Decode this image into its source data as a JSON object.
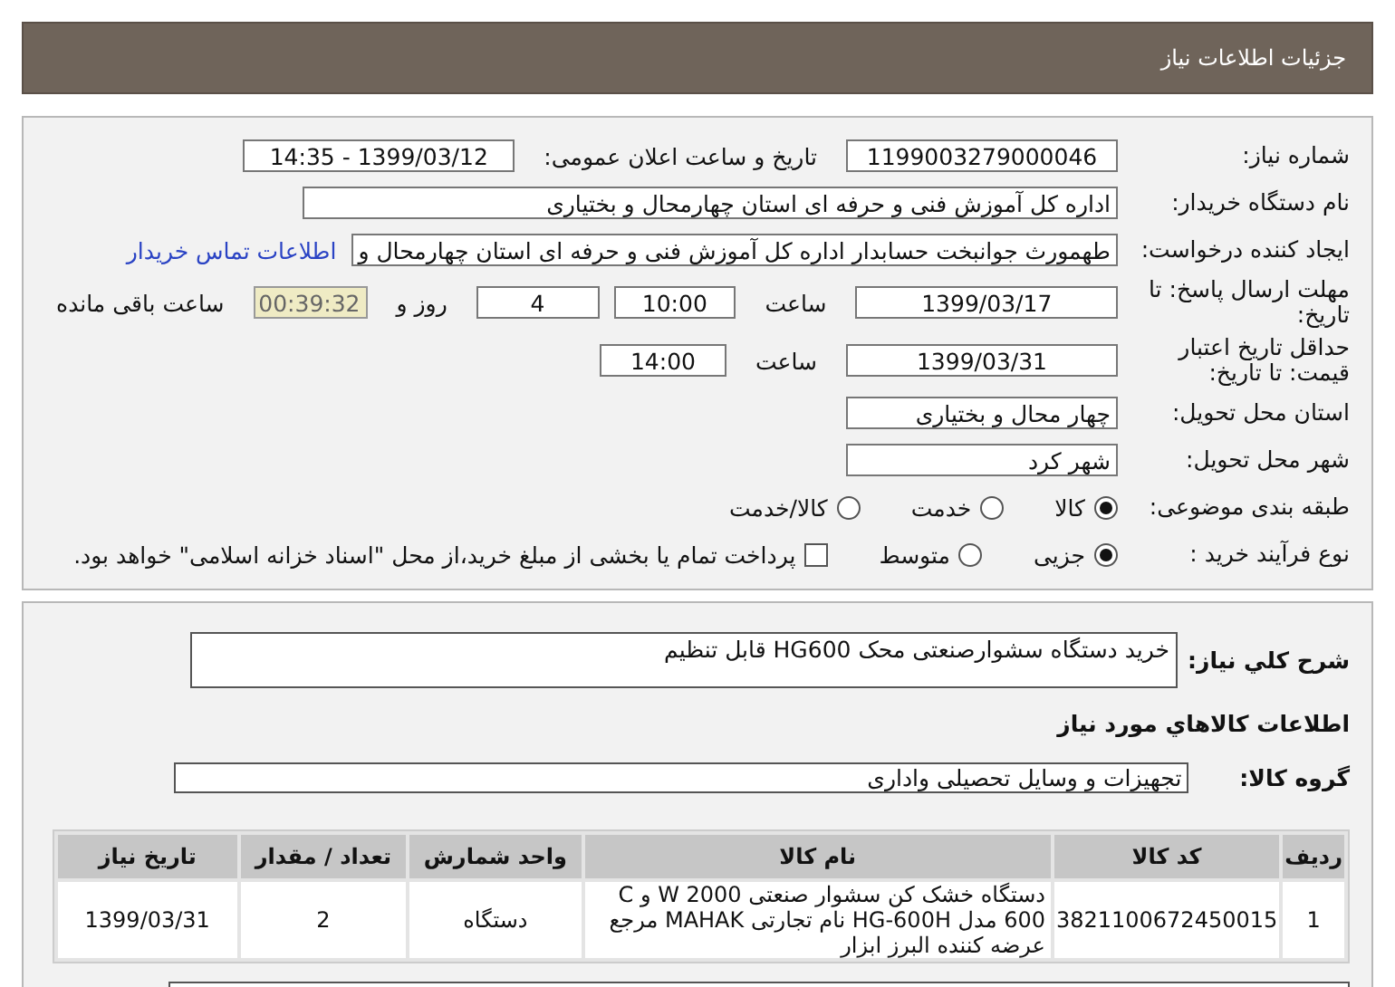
{
  "header": {
    "title": "جزئیات اطلاعات نیاز"
  },
  "details": {
    "rows": [
      {
        "label": "شماره نیاز:",
        "items": [
          {
            "kind": "field",
            "value": "1199003279000046"
          },
          {
            "kind": "text",
            "text": "تاریخ و ساعت اعلان عمومی:"
          },
          {
            "kind": "field",
            "value": "1399/03/12 - 14:35"
          }
        ]
      },
      {
        "label": "نام دستگاه خریدار:",
        "items": [
          {
            "kind": "long-field",
            "value": "اداره کل آموزش فنی و حرفه ای استان چهارمحال و بختیاری"
          }
        ]
      },
      {
        "label": "ایجاد کننده درخواست:",
        "items": [
          {
            "kind": "auto-field",
            "value": "طهمورث جوانبخت حسابدار اداره کل آموزش فنی و حرفه ای استان چهارمحال و"
          },
          {
            "kind": "link",
            "text": "اطلاعات تماس خریدار"
          }
        ]
      },
      {
        "label": "مهلت ارسال پاسخ: تا تاریخ:",
        "items": [
          {
            "kind": "field",
            "value": "1399/03/17"
          },
          {
            "kind": "text",
            "text": "ساعت"
          },
          {
            "kind": "short-field",
            "value": "10:00"
          },
          {
            "kind": "short-field",
            "value": "4"
          },
          {
            "kind": "text",
            "text": "روز و"
          },
          {
            "kind": "timer",
            "value": "00:39:32"
          },
          {
            "kind": "text",
            "text": "ساعت باقی مانده"
          }
        ]
      },
      {
        "label": "حداقل تاریخ اعتبار قیمت: تا تاریخ:",
        "items": [
          {
            "kind": "field",
            "value": "1399/03/31"
          },
          {
            "kind": "text",
            "text": "ساعت"
          },
          {
            "kind": "short-field",
            "value": "14:00"
          }
        ]
      },
      {
        "label": "استان محل تحویل:",
        "items": [
          {
            "kind": "text-field",
            "value": "چهار محال و بختیاری"
          }
        ]
      },
      {
        "label": "شهر محل تحویل:",
        "items": [
          {
            "kind": "text-field",
            "value": "شهر کرد"
          }
        ]
      },
      {
        "label": "طبقه بندی موضوعی:",
        "items": [
          {
            "kind": "radio",
            "text": "کالا",
            "selected": true
          },
          {
            "kind": "radio",
            "text": "خدمت",
            "selected": false
          },
          {
            "kind": "radio",
            "text": "کالا/خدمت",
            "selected": false
          }
        ]
      },
      {
        "label": "نوع فرآیند خرید :",
        "items": [
          {
            "kind": "radio",
            "text": "جزیی",
            "selected": true
          },
          {
            "kind": "radio",
            "text": "متوسط",
            "selected": false
          },
          {
            "kind": "checkbox",
            "text": "پرداخت تمام یا بخشی از مبلغ خرید،از محل \"اسناد خزانه اسلامی\" خواهد بود.",
            "checked": false
          }
        ]
      }
    ]
  },
  "description": {
    "label": "شرح کلي نياز:",
    "value": "خرید دستگاه سشوارصنعتی محک HG600 قابل تنظیم"
  },
  "goods_title": "اطلاعات کالاهاي مورد نياز",
  "goods_group": {
    "label": "گروه کالا:",
    "value": "تجهیزات و وسایل تحصیلی واداری"
  },
  "table": {
    "columns": [
      "ردیف",
      "کد کالا",
      "نام کالا",
      "واحد شمارش",
      "تعداد / مقدار",
      "تاریخ نیاز"
    ],
    "rows": [
      [
        "1",
        "3821100672450015",
        "دستگاه خشک کن سشوار صنعتی W 2000 و C 600 مدل HG-600H نام تجارتی MAHAK مرجع عرضه کننده البرز ابزار",
        "دستگاه",
        "2",
        "1399/03/31"
      ]
    ]
  }
}
